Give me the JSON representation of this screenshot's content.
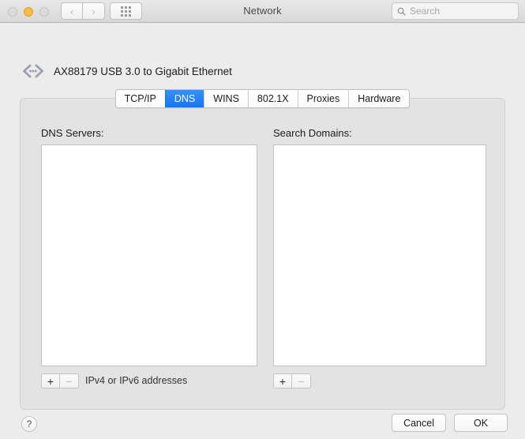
{
  "window": {
    "title": "Network"
  },
  "toolbar": {
    "traffic_lights": [
      {
        "name": "close",
        "state": "inactive"
      },
      {
        "name": "minimize",
        "state": "active",
        "color": "#fdbc40"
      },
      {
        "name": "zoom",
        "state": "inactive"
      }
    ],
    "back_glyph": "‹",
    "forward_glyph": "›",
    "show_all_label": "",
    "search": {
      "placeholder": "Search",
      "value": ""
    }
  },
  "device": {
    "icon": "ethernet-icon",
    "name": "AX88179 USB 3.0 to Gigabit Ethernet"
  },
  "tabs": [
    {
      "label": "TCP/IP",
      "selected": false
    },
    {
      "label": "DNS",
      "selected": true
    },
    {
      "label": "WINS",
      "selected": false
    },
    {
      "label": "802.1X",
      "selected": false
    },
    {
      "label": "Proxies",
      "selected": false
    },
    {
      "label": "Hardware",
      "selected": false
    }
  ],
  "selected_tab": "DNS",
  "accent_color": "#1476f5",
  "panels": {
    "dns_servers": {
      "label": "DNS Servers:",
      "items": [],
      "add_label": "+",
      "remove_label": "−",
      "add_enabled": true,
      "remove_enabled": false,
      "hint": "IPv4 or IPv6 addresses"
    },
    "search_domains": {
      "label": "Search Domains:",
      "items": [],
      "add_label": "+",
      "remove_label": "−",
      "add_enabled": true,
      "remove_enabled": false
    }
  },
  "footer": {
    "help_label": "?",
    "cancel_label": "Cancel",
    "ok_label": "OK"
  }
}
